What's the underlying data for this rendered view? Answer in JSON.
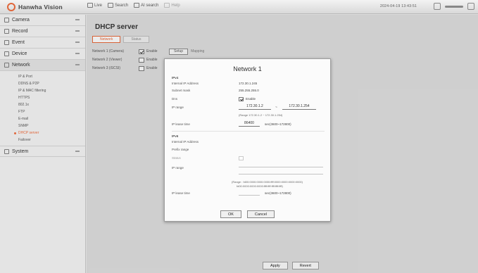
{
  "app": {
    "brand": "Hanwha Vision"
  },
  "topnav": [
    {
      "label": "Live",
      "faded": false
    },
    {
      "label": "Search",
      "faded": false
    },
    {
      "label": "AI search",
      "faded": false
    },
    {
      "label": "Help",
      "faded": true
    }
  ],
  "clock": "2024-04-19 13:43:51",
  "sidebar": {
    "sections": [
      {
        "label": "Camera",
        "icon": "camera-icon",
        "active": false
      },
      {
        "label": "Record",
        "icon": "record-icon",
        "active": false
      },
      {
        "label": "Event",
        "icon": "event-icon",
        "active": false
      },
      {
        "label": "Device",
        "icon": "device-icon",
        "active": false
      },
      {
        "label": "Network",
        "icon": "network-icon",
        "active": true
      }
    ],
    "network_items": [
      {
        "label": "IP & Port",
        "current": false
      },
      {
        "label": "DDNS & P2P",
        "current": false
      },
      {
        "label": "IP & MAC filtering",
        "current": false
      },
      {
        "label": "HTTPS",
        "current": false
      },
      {
        "label": "802.1x",
        "current": false
      },
      {
        "label": "FTP",
        "current": false
      },
      {
        "label": "E-mail",
        "current": false
      },
      {
        "label": "SNMP",
        "current": false
      },
      {
        "label": "DHCP server",
        "current": true
      },
      {
        "label": "Failover",
        "current": false
      }
    ],
    "system": {
      "label": "System",
      "icon": "system-icon"
    }
  },
  "page": {
    "title": "DHCP server",
    "tabs": [
      {
        "label": "Network",
        "active": true
      },
      {
        "label": "Status",
        "active": false
      }
    ],
    "rows": [
      {
        "name": "Network 1 (Camera)",
        "enable_label": "Enable",
        "checked": true,
        "setup": "Setup",
        "mapping": "Mapping"
      },
      {
        "name": "Network 2 (Viewer)",
        "enable_label": "Enable",
        "checked": false
      },
      {
        "name": "Network 3 (iSCSI)",
        "enable_label": "Enable",
        "checked": false
      }
    ],
    "apply_label": "Apply",
    "revert_label": "Revert"
  },
  "modal": {
    "title": "Network 1",
    "ipv4": {
      "heading": "IPv4",
      "internal_ip_label": "Internal IP Address",
      "internal_ip_value": "172.30.1.245",
      "subnet_label": "Subnet mask",
      "subnet_value": "255.255.255.0",
      "dns_label": "Dns",
      "enable_label": "Enable",
      "ip_range_label": "IP range",
      "ip_range_start": "172.30.1.2",
      "ip_range_end": "172.30.1.254",
      "range_note": "(Range 172.30.1.2 ~ 172.30.1.254)",
      "lease_label": "IP lease time",
      "lease_value": "86400",
      "lease_unit": "sec(3600~172800)"
    },
    "ipv6": {
      "heading": "IPv6",
      "internal_ip_label": "Internal IP Address",
      "prefix_label": "Prefix range",
      "status_label": "Status",
      "ip_range_label": "IP range",
      "range_note": "(Range : fd00:0000:0000:0000:ffff:0000:0000:0000:0000)",
      "range_note2": "fd00:0000:0000:0000:ffff:ffff:ffff:ffff:ffff)",
      "lease_label": "IP lease time",
      "lease_unit": "sec(3600~172800)"
    },
    "ok_label": "OK",
    "cancel_label": "Cancel"
  }
}
